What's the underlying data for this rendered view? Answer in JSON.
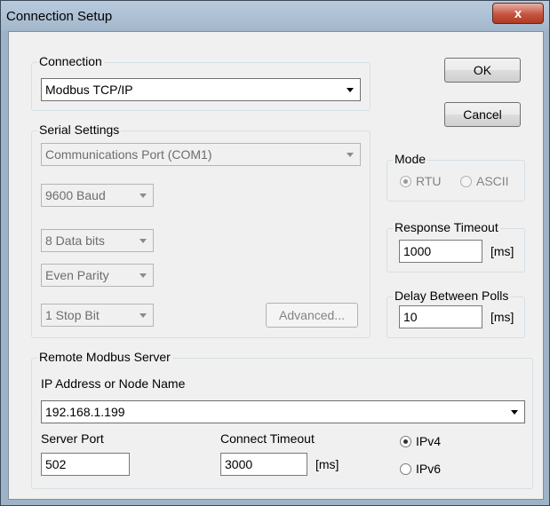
{
  "window": {
    "title": "Connection Setup",
    "close_symbol": "x"
  },
  "connection": {
    "group_label": "Connection",
    "selected": "Modbus TCP/IP"
  },
  "buttons": {
    "ok": "OK",
    "cancel": "Cancel"
  },
  "serial": {
    "group_label": "Serial Settings",
    "port": "Communications Port (COM1)",
    "baud": "9600 Baud",
    "data_bits": "8 Data bits",
    "parity": "Even Parity",
    "stop_bits": "1 Stop Bit",
    "advanced": "Advanced..."
  },
  "mode": {
    "group_label": "Mode",
    "rtu": "RTU",
    "ascii": "ASCII",
    "selected": "RTU"
  },
  "response_timeout": {
    "group_label": "Response Timeout",
    "value": "1000",
    "unit": "[ms]"
  },
  "delay_between_polls": {
    "group_label": "Delay Between Polls",
    "value": "10",
    "unit": "[ms]"
  },
  "remote": {
    "group_label": "Remote Modbus Server",
    "ip_label": "IP Address or Node Name",
    "ip_value": "192.168.1.199",
    "server_port_label": "Server Port",
    "server_port_value": "502",
    "connect_timeout_label": "Connect Timeout",
    "connect_timeout_value": "3000",
    "connect_timeout_unit": "[ms]",
    "ipv4": "IPv4",
    "ipv6": "IPv6",
    "selected_ip_version": "IPv4"
  },
  "colors": {
    "title_bar": "#a8bbcf",
    "close_button": "#c6543f",
    "dialog_bg": "#f0f0f0"
  }
}
